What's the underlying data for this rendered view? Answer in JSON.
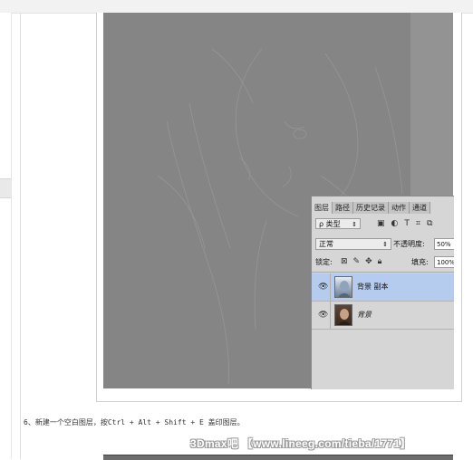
{
  "layers_panel": {
    "tabs": [
      {
        "label": "图层"
      },
      {
        "label": "路径"
      },
      {
        "label": "历史记录"
      },
      {
        "label": "动作"
      },
      {
        "label": "通道"
      }
    ],
    "filter_kind": "ρ 类型",
    "filter_icons": [
      "image-icon",
      "adjustment-icon",
      "type-icon",
      "shape-icon",
      "smart-object-icon"
    ],
    "blend_mode": "正常",
    "opacity_label": "不透明度:",
    "opacity_value": "50%",
    "lock_label": "锁定:",
    "fill_label": "填充:",
    "fill_value": "100%",
    "layers": [
      {
        "name": "背景 副本",
        "selected": true,
        "visible": true
      },
      {
        "name": "背景",
        "selected": false,
        "visible": true
      }
    ]
  },
  "caption": "6、新建一个空白图层，按Ctrl + Alt + Shift + E 盖印图层。",
  "watermark": "3Dmax吧 【www.lineeg.com/tieba/1771】",
  "colors": {
    "photo_gray": "#858585",
    "selected_layer": "#b6ccef",
    "panel_bg": "#d6d6d6"
  }
}
